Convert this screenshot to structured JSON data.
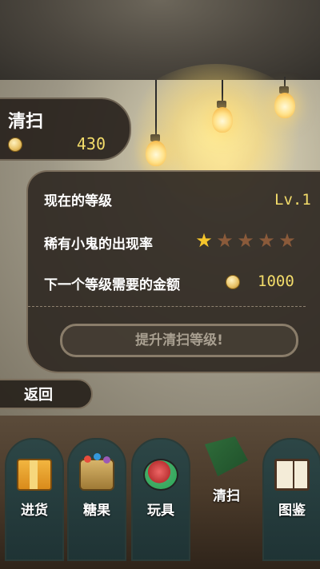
{
  "title": {
    "label": "清扫",
    "coin_amount": "430"
  },
  "panel": {
    "rows": [
      {
        "label": "现在的等级",
        "value": "Lv.1"
      },
      {
        "label": "稀有小鬼的出现率",
        "stars_filled": 1,
        "stars_total": 5
      },
      {
        "label": "下一个等级需要的金额",
        "value": "1000"
      }
    ],
    "upgrade_button": "提升清扫等级!"
  },
  "back_button": "返回",
  "nav": {
    "items": [
      {
        "label": "进货",
        "icon": "box-icon"
      },
      {
        "label": "糖果",
        "icon": "candy-basket-icon"
      },
      {
        "label": "玩具",
        "icon": "toy-icon"
      },
      {
        "label": "清扫",
        "icon": "broom-icon",
        "active": true
      },
      {
        "label": "图鉴",
        "icon": "book-icon"
      }
    ]
  },
  "colors": {
    "accent_gold": "#f3dc6a",
    "panel_bg": "#302a23",
    "star_on": "#f5c52b",
    "star_off": "#8a5a3a"
  }
}
